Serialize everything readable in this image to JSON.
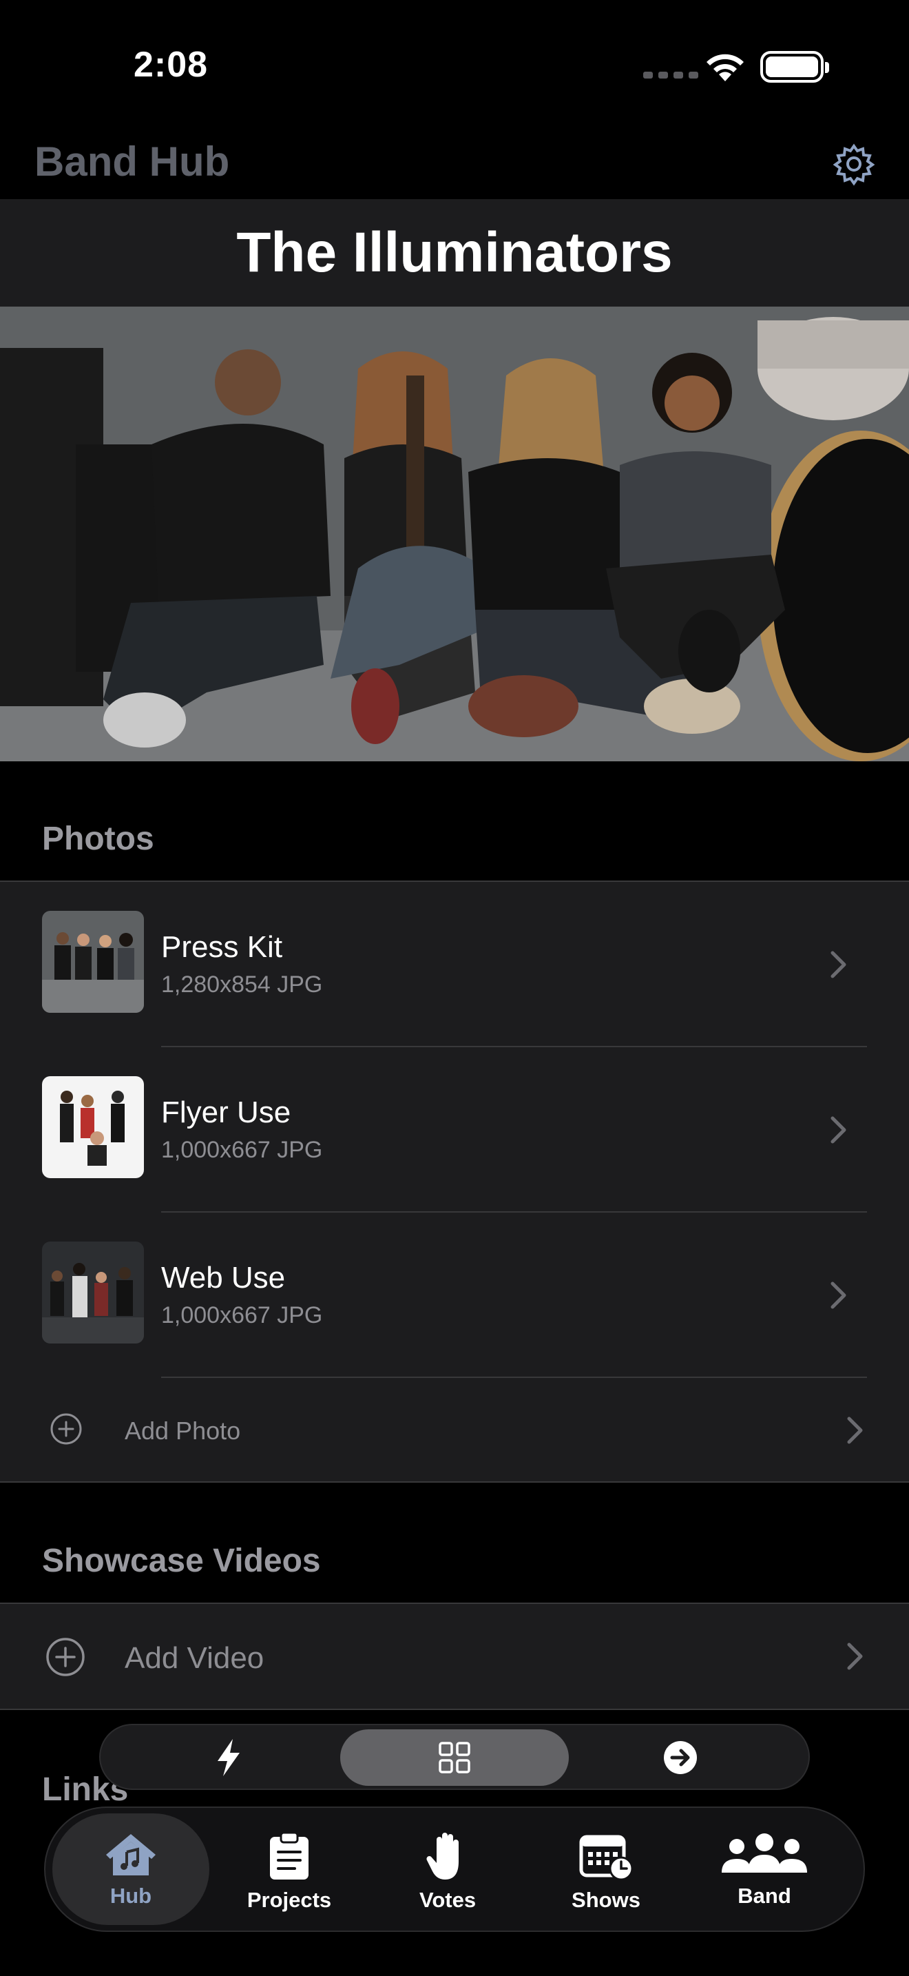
{
  "status_bar": {
    "time": "2:08"
  },
  "header": {
    "app_title": "Band Hub",
    "band_name": "The Illuminators"
  },
  "photos": {
    "section_title": "Photos",
    "items": [
      {
        "title": "Press Kit",
        "subtitle": "1,280x854 JPG"
      },
      {
        "title": "Flyer Use",
        "subtitle": "1,000x667 JPG"
      },
      {
        "title": "Web Use",
        "subtitle": "1,000x667 JPG"
      }
    ],
    "add_label": "Add Photo"
  },
  "videos": {
    "section_title": "Showcase Videos",
    "add_label": "Add Video"
  },
  "links": {
    "section_title": "Links"
  },
  "segmented": {
    "items": [
      "bolt-icon",
      "grid-icon",
      "arrow-right-circle-icon"
    ],
    "selected": "grid-icon"
  },
  "tabbar": {
    "items": [
      {
        "label": "Hub",
        "icon": "house-music-icon"
      },
      {
        "label": "Projects",
        "icon": "clipboard-icon"
      },
      {
        "label": "Votes",
        "icon": "hand-raised-icon"
      },
      {
        "label": "Shows",
        "icon": "calendar-clock-icon"
      },
      {
        "label": "Band",
        "icon": "people-icon"
      }
    ],
    "selected": "Hub"
  },
  "colors": {
    "background": "#000000",
    "card": "#1c1c1e",
    "secondary_text": "#8e8e93",
    "tab_active_text": "#8fa3c4"
  }
}
